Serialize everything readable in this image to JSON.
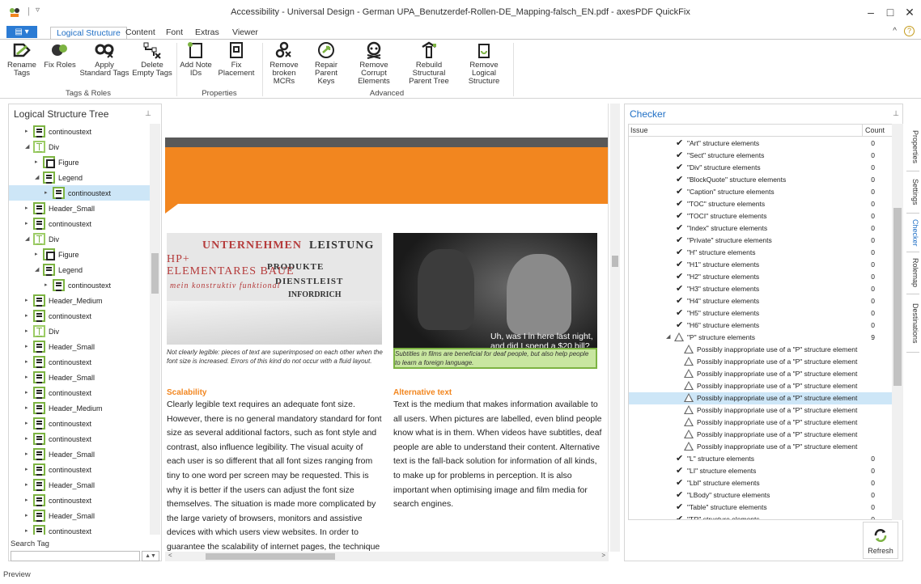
{
  "window": {
    "title": "Accessibility - Universal Design - German UPA_Benutzerdef-Rollen-DE_Mapping-falsch_EN.pdf - axesPDF QuickFix",
    "quick_access": "▿",
    "minimize": "–",
    "maximize": "□",
    "close": "✕"
  },
  "ribbon_tabs": {
    "file": "▤ ▾",
    "tabs": [
      "Logical Structure",
      "Content",
      "Font",
      "Extras",
      "Viewer"
    ],
    "collapse": "^",
    "help": "?"
  },
  "ribbon": {
    "buttons": [
      "Rename Tags",
      "Fix Roles",
      "Apply Standard Tags",
      "Delete Empty Tags",
      "Add Note IDs",
      "Fix Placement",
      "Remove broken MCRs",
      "Repair Parent Keys",
      "Remove Corrupt Elements",
      "Rebuild Structural Parent Tree",
      "Remove Logical Structure"
    ],
    "groups": [
      "Tags & Roles",
      "Properties",
      "Advanced"
    ]
  },
  "tree_panel": {
    "title": "Logical Structure Tree",
    "pin": "⊥",
    "search_label": "Search Tag",
    "search_value": "",
    "spin": "▲▼",
    "items": [
      {
        "label": "continoustext",
        "icon": "lines"
      },
      {
        "label": "Div",
        "icon": "grid"
      },
      {
        "label": "Figure",
        "icon": "box"
      },
      {
        "label": "Legend",
        "icon": "lines"
      },
      {
        "label": "continoustext",
        "icon": "lines"
      },
      {
        "label": "Header_Small",
        "icon": "lines"
      },
      {
        "label": "continoustext",
        "icon": "lines"
      },
      {
        "label": "Div",
        "icon": "grid"
      },
      {
        "label": "Figure",
        "icon": "box"
      },
      {
        "label": "Legend",
        "icon": "lines"
      },
      {
        "label": "continoustext",
        "icon": "lines"
      },
      {
        "label": "Header_Medium",
        "icon": "lines"
      },
      {
        "label": "continoustext",
        "icon": "lines"
      },
      {
        "label": "Div",
        "icon": "grid"
      },
      {
        "label": "Header_Small",
        "icon": "lines"
      },
      {
        "label": "continoustext",
        "icon": "lines"
      },
      {
        "label": "Header_Small",
        "icon": "lines"
      },
      {
        "label": "continoustext",
        "icon": "lines"
      },
      {
        "label": "Header_Medium",
        "icon": "lines"
      },
      {
        "label": "continoustext",
        "icon": "lines"
      },
      {
        "label": "continoustext",
        "icon": "lines"
      },
      {
        "label": "Header_Small",
        "icon": "lines"
      },
      {
        "label": "continoustext",
        "icon": "lines"
      },
      {
        "label": "Header_Small",
        "icon": "lines"
      },
      {
        "label": "continoustext",
        "icon": "lines"
      },
      {
        "label": "Header_Small",
        "icon": "lines"
      },
      {
        "label": "continoustext",
        "icon": "lines"
      }
    ]
  },
  "document": {
    "image1_words": [
      "UNTERNEHMEN",
      "LEISTUNG",
      "HP+",
      "ELEMENTARES BAUE",
      "PRODUKTE",
      "DIENSTLEIST",
      "mein konstruktiv funktional",
      "INFORDRICH"
    ],
    "image2_subtitle": "Uh, was I in here last night,\nand did I spend a $20 bill?",
    "caption_left": "Not clearly legible: pieces of text are superimposed on each other when the font size is increased. Errors of this kind do not occur with a fluid layout.",
    "caption_right": "Subtitles in films are beneficial for deaf people, but also help people to learn a foreign language.",
    "left_heading": "Scalability",
    "left_text": "Clearly legible text requires an adequate font size. However, there is no general mandatory standard for font size as several additional factors, such as font style and contrast, also influence legibility. The visual acuity of each user is so different that all font sizes ranging from tiny to one word per screen may be requested. This is why it is better if the users can adjust the font size themselves. The situation is made more complicated by the large variety of browsers, monitors and assistive devices with which users view websites. In order to guarantee the scalability of internet pages, the technique of fluid layout is used in web design, which allows the flexible adjustment of all font",
    "right_heading": "Alternative text",
    "right_text": "Text is the medium that makes information available to all users. When pictures are labelled, even blind people know what is in them. When videos have subtitles, deaf people are able to understand their content. Alternative text is the fall-back solution for information of all kinds, to make up for problems in perception. It is also important when optimising image and film media for search engines."
  },
  "checker": {
    "title": "Checker",
    "pin": "⊥",
    "col_issue": "Issue",
    "col_count": "Count",
    "rows": [
      {
        "text": "\"Art\" structure elements",
        "count": "0",
        "kind": "check"
      },
      {
        "text": "\"Sect\" structure elements",
        "count": "0",
        "kind": "check"
      },
      {
        "text": "\"Div\" structure elements",
        "count": "0",
        "kind": "check"
      },
      {
        "text": "\"BlockQuote\" structure elements",
        "count": "0",
        "kind": "check"
      },
      {
        "text": "\"Caption\" structure elements",
        "count": "0",
        "kind": "check"
      },
      {
        "text": "\"TOC\" structure elements",
        "count": "0",
        "kind": "check"
      },
      {
        "text": "\"TOCI\" structure elements",
        "count": "0",
        "kind": "check"
      },
      {
        "text": "\"Index\" structure elements",
        "count": "0",
        "kind": "check"
      },
      {
        "text": "\"Private\" structure elements",
        "count": "0",
        "kind": "check"
      },
      {
        "text": "\"H\" structure elements",
        "count": "0",
        "kind": "check"
      },
      {
        "text": "\"H1\" structure elements",
        "count": "0",
        "kind": "check"
      },
      {
        "text": "\"H2\" structure elements",
        "count": "0",
        "kind": "check"
      },
      {
        "text": "\"H3\" structure elements",
        "count": "0",
        "kind": "check"
      },
      {
        "text": "\"H4\" structure elements",
        "count": "0",
        "kind": "check"
      },
      {
        "text": "\"H5\" structure elements",
        "count": "0",
        "kind": "check"
      },
      {
        "text": "\"H6\" structure elements",
        "count": "0",
        "kind": "check"
      },
      {
        "text": "\"P\" structure elements",
        "count": "9",
        "kind": "warn-parent"
      },
      {
        "text": "Possibly inappropriate use of a \"P\" structure element",
        "count": "",
        "kind": "warn"
      },
      {
        "text": "Possibly inappropriate use of a \"P\" structure element",
        "count": "",
        "kind": "warn"
      },
      {
        "text": "Possibly inappropriate use of a \"P\" structure element",
        "count": "",
        "kind": "warn"
      },
      {
        "text": "Possibly inappropriate use of a \"P\" structure element",
        "count": "",
        "kind": "warn"
      },
      {
        "text": "Possibly inappropriate use of a \"P\" structure element",
        "count": "",
        "kind": "warn"
      },
      {
        "text": "Possibly inappropriate use of a \"P\" structure element",
        "count": "",
        "kind": "warn"
      },
      {
        "text": "Possibly inappropriate use of a \"P\" structure element",
        "count": "",
        "kind": "warn"
      },
      {
        "text": "Possibly inappropriate use of a \"P\" structure element",
        "count": "",
        "kind": "warn"
      },
      {
        "text": "Possibly inappropriate use of a \"P\" structure element",
        "count": "",
        "kind": "warn"
      },
      {
        "text": "\"L\" structure elements",
        "count": "0",
        "kind": "check"
      },
      {
        "text": "\"LI\" structure elements",
        "count": "0",
        "kind": "check"
      },
      {
        "text": "\"Lbl\" structure elements",
        "count": "0",
        "kind": "check"
      },
      {
        "text": "\"LBody\" structure elements",
        "count": "0",
        "kind": "check"
      },
      {
        "text": "\"Table\" structure elements",
        "count": "0",
        "kind": "check"
      },
      {
        "text": "\"TR\" structure elements",
        "count": "0",
        "kind": "check"
      }
    ],
    "refresh": "Refresh"
  },
  "side_tabs": [
    "Properties",
    "Settings",
    "Checker",
    "Rolemap",
    "Destinations"
  ],
  "status": "Preview",
  "colors": {
    "accent": "#1f6fc5",
    "orange": "#f2861f",
    "tag_green": "#7cb342",
    "selection": "#cde6f7"
  }
}
